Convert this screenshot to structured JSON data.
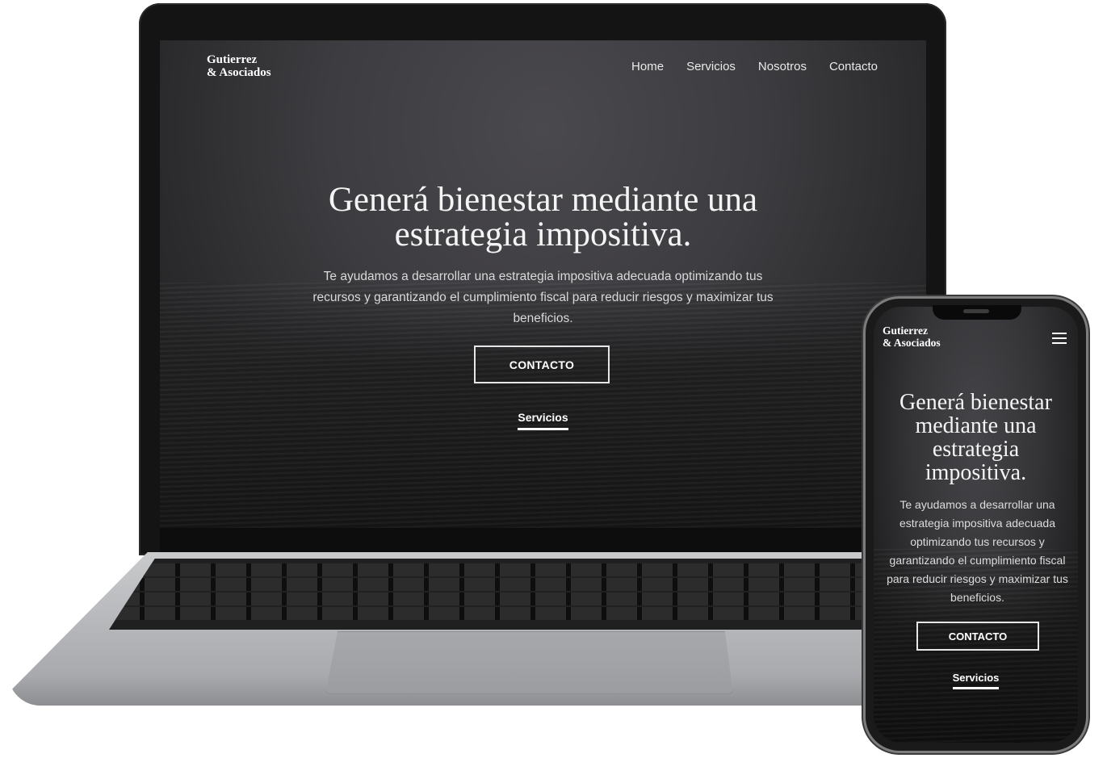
{
  "desktop": {
    "logo": {
      "line1": "Gutierrez",
      "line2": "& Asociados"
    },
    "nav": [
      "Home",
      "Servicios",
      "Nosotros",
      "Contacto"
    ],
    "hero": {
      "title_line1": "Generá bienestar mediante una",
      "title_line2": "estrategia impositiva.",
      "subtitle": "Te ayudamos a desarrollar una estrategia impositiva adecuada optimizando tus recursos y garantizando el cumplimiento fiscal para reducir riesgos y maximizar tus beneficios.",
      "cta_label": "CONTACTO",
      "link_label": "Servicios"
    }
  },
  "mobile": {
    "logo": {
      "line1": "Gutierrez",
      "line2": "& Asociados"
    },
    "menu_icon": "hamburger-icon",
    "hero": {
      "title_lines": [
        "Generá bienestar",
        "mediante una",
        "estrategia",
        "impositiva."
      ],
      "subtitle": "Te ayudamos a desarrollar una estrategia impositiva adecuada optimizando tus recursos y garantizando el cumplimiento fiscal para reducir riesgos y maximizar tus beneficios.",
      "cta_label": "CONTACTO",
      "link_label": "Servicios"
    }
  }
}
